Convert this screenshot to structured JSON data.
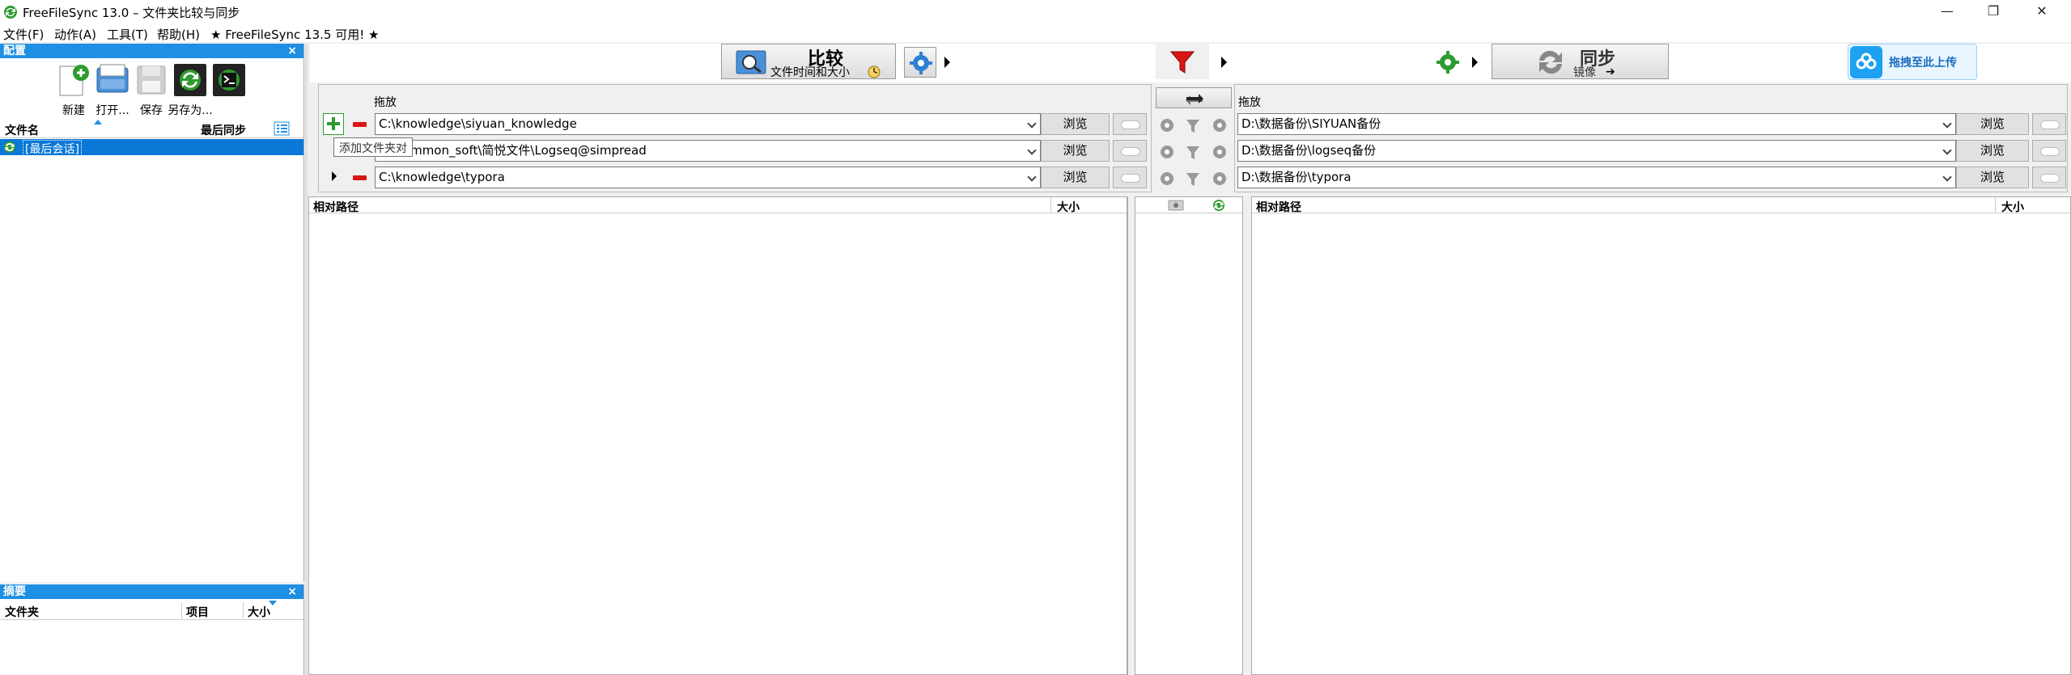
{
  "window": {
    "title": "FreeFileSync 13.0 – 文件夹比较与同步",
    "minimize_glyph": "—",
    "restore_glyph": "❐",
    "close_glyph": "✕"
  },
  "menu": {
    "file": "文件(F)",
    "actions": "动作(A)",
    "tools": "工具(T)",
    "help": "帮助(H)",
    "update_notice": "★ FreeFileSync 13.5 可用! ★"
  },
  "config_panel": {
    "title": "配置",
    "close": "×",
    "buttons": {
      "new": "新建",
      "open": "打开...",
      "save": "保存",
      "save_as": "另存为..."
    },
    "col_filename": "文件名",
    "col_last_sync": "最后同步",
    "items": [
      {
        "label": "[最后会话]"
      }
    ]
  },
  "summary_panel": {
    "title": "摘要",
    "close": "×",
    "col_folder": "文件夹",
    "col_items": "项目",
    "col_size": "大小"
  },
  "toolbar": {
    "compare_title": "比较",
    "compare_sub": "文件时间和大小",
    "sync_title": "同步",
    "sync_sub": "镜像",
    "upload_label": "拖拽至此上传"
  },
  "left_side": {
    "drag_label": "拖放",
    "browse": "浏览",
    "tooltip": "添加文件夹对",
    "paths": [
      "C:\\knowledge\\siyuan_knowledge",
      "D:\\common_soft\\简悦文件\\Logseq@simpread",
      "C:\\knowledge\\typora"
    ]
  },
  "right_side": {
    "drag_label": "拖放",
    "browse": "浏览",
    "paths": [
      "D:\\数据备份\\SIYUAN备份",
      "D:\\数据备份\\logseq备份",
      "D:\\数据备份\\typora"
    ]
  },
  "grid": {
    "left_col_path": "相对路径",
    "left_col_size": "大小",
    "right_col_path": "相对路径",
    "right_col_size": "大小"
  },
  "colors": {
    "accent_blue": "#1f8fe3",
    "selection_blue": "#0a78d7",
    "filter_red": "#d91515",
    "gear_green": "#2e9b2e",
    "upload_blue": "#1ea1f1"
  }
}
